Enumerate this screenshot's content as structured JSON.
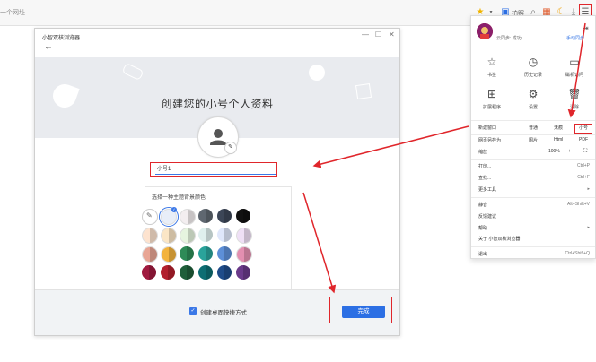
{
  "toolbar": {
    "address_placeholder": "一个网址",
    "bookmark_label": "拍照",
    "menu_icon": "menu-icon"
  },
  "dialog": {
    "title": "小智双核浏览器",
    "headline": "创建您的小号个人资料",
    "name_value": "小号1",
    "theme_label": "选择一种主题背景颜色",
    "shortcut_label": "创建桌面快捷方式",
    "done_label": "完成"
  },
  "theme_swatches": [
    [
      "#ffffff",
      "#e8eef8",
      "#f3eef0",
      "#5f6770",
      "#3c4657",
      "#111111"
    ],
    [
      "#fde3cf",
      "#fbe6c6",
      "#e6f4df",
      "#dff0ee",
      "#dfe7fb",
      "#efe0f6"
    ],
    [
      "#e8a594",
      "#f3b33d",
      "#2e8b57",
      "#2aa39b",
      "#5d8fd8",
      "#e38fb0"
    ],
    [
      "#a01a3f",
      "#b21f2d",
      "#1f5f3a",
      "#0e6e73",
      "#1f4c8a",
      "#6a3a8a"
    ]
  ],
  "menu": {
    "sync_status": "云同步: 成功",
    "manage_link": "手动同步",
    "grid": [
      {
        "icon": "star-icon",
        "label": "书签"
      },
      {
        "icon": "clock-icon",
        "label": "历史记录"
      },
      {
        "icon": "monitor-icon",
        "label": "磁机访问"
      },
      {
        "icon": "grid-icon",
        "label": "扩展程序"
      },
      {
        "icon": "gear-icon",
        "label": "设置"
      },
      {
        "icon": "trash-icon",
        "label": "清除"
      }
    ],
    "new_window_row": {
      "label": "新建窗口",
      "normal": "普通",
      "incognito": "无痕",
      "small": "小号"
    },
    "save_row": {
      "label": "网页另存为",
      "image": "图片",
      "html": "Html",
      "pdf": "PDF"
    },
    "zoom_row": {
      "label": "缩放",
      "minus": "−",
      "value": "100%",
      "plus": "+"
    },
    "items": [
      {
        "label": "打印...",
        "shortcut": "Ctrl+P"
      },
      {
        "label": "查找...",
        "shortcut": "Ctrl+F"
      },
      {
        "label": "更多工具",
        "shortcut": "▸"
      },
      {
        "label": "静音",
        "shortcut": "Alt+Shift+V"
      },
      {
        "label": "反馈建议",
        "shortcut": ""
      },
      {
        "label": "帮助",
        "shortcut": "▸"
      },
      {
        "label": "关于 小智双核浏览器",
        "shortcut": ""
      },
      {
        "label": "退出",
        "shortcut": "Ctrl+Shift+Q"
      }
    ]
  },
  "colors": {
    "accent": "#2c6fe4",
    "highlight": "#e0262b"
  }
}
